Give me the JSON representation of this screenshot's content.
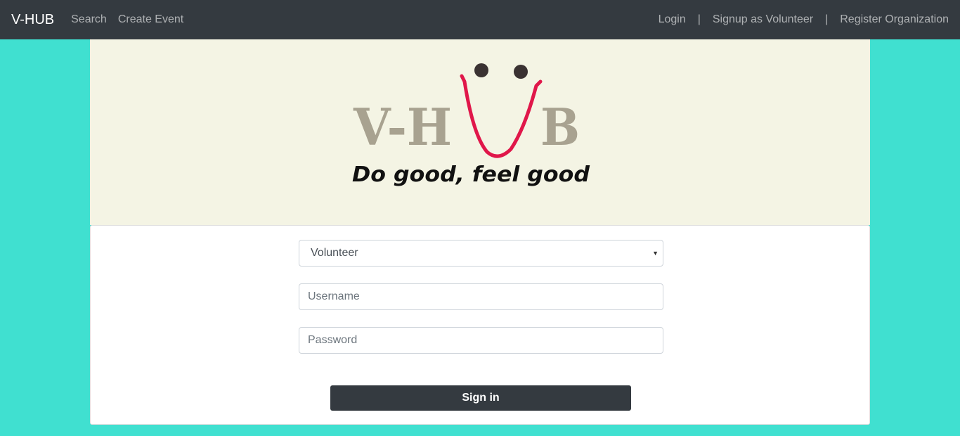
{
  "navbar": {
    "brand": "V-HUB",
    "left_links": [
      "Search",
      "Create Event"
    ],
    "right_links": [
      "Login",
      "Signup as Volunteer",
      "Register Organization"
    ],
    "separator": "|"
  },
  "logo": {
    "wordmark_left": "V-H",
    "wordmark_right": "B",
    "tagline": "Do good, feel good"
  },
  "form": {
    "role_select": {
      "value": "Volunteer"
    },
    "username": {
      "placeholder": "Username",
      "value": ""
    },
    "password": {
      "placeholder": "Password",
      "value": ""
    },
    "submit_label": "Sign in"
  },
  "colors": {
    "page_background": "#40e0d0",
    "navbar": "#343a40",
    "banner": "#f4f4e4",
    "logo_letters": "#a8a290",
    "smile": "#e0174a"
  }
}
